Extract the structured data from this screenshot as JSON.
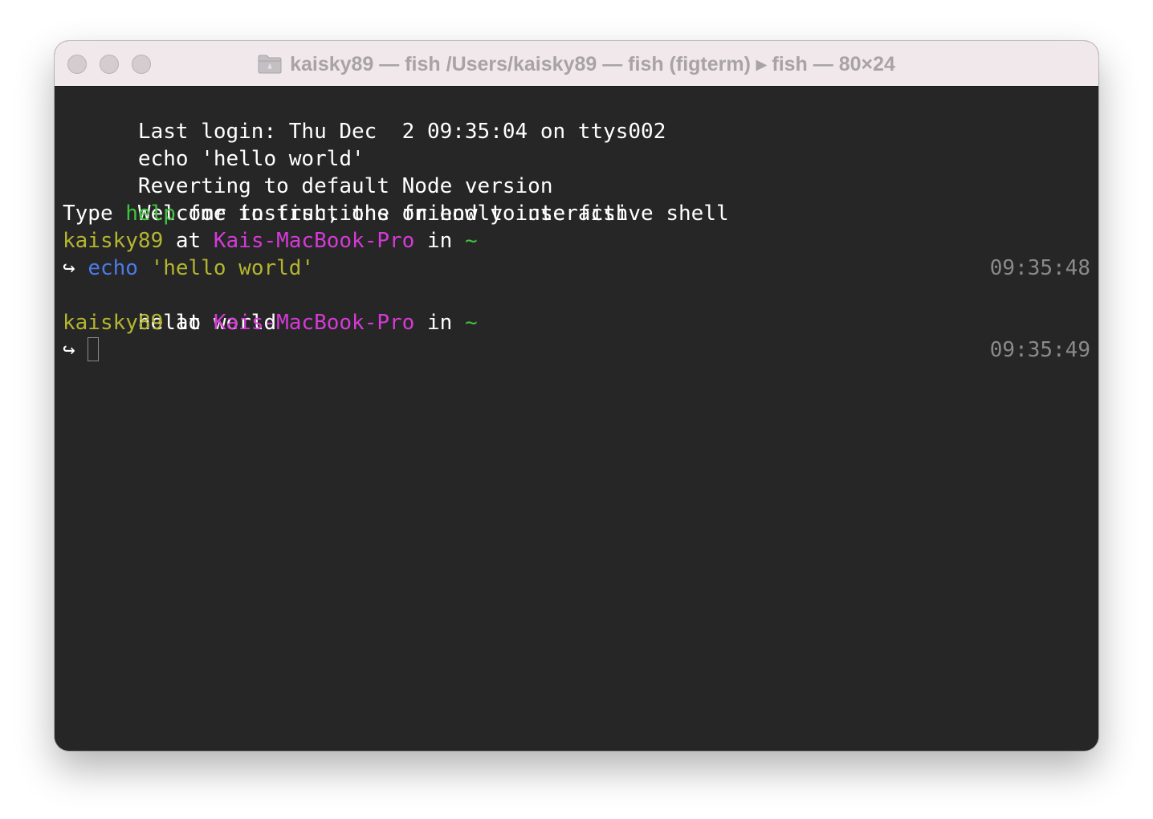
{
  "window": {
    "title": "kaisky89 — fish /Users/kaisky89 — fish (figterm) ▸ fish — 80×24",
    "folder_icon": "folder-icon"
  },
  "colors": {
    "background": "#262626",
    "text": "#ffffff",
    "green": "#3fc43f",
    "yellow": "#b4b530",
    "magenta": "#d53ad6",
    "blue": "#4b7bea",
    "timestamp": "#8a8a8a"
  },
  "terminal": {
    "last_login": "Last login: Thu Dec  2 09:35:04 on ttys002",
    "echo_line": "echo 'hello world'",
    "reverting": "Reverting to default Node version",
    "welcome": "Welcome to fish, the friendly interactive shell",
    "type_help": {
      "pre": "Type ",
      "help": "help",
      "post": " for instructions on how to use fish"
    },
    "prompt1": {
      "user": "kaisky89",
      "at": " at ",
      "host": "Kais-MacBook-Pro",
      "in": " in ",
      "dir": "~"
    },
    "command1": {
      "arrow": "↪",
      "cmd": "echo",
      "arg": "'hello world'",
      "timestamp": "09:35:48"
    },
    "output1": "hello world",
    "prompt2": {
      "user": "kaisky89",
      "at": " at ",
      "host": "Kais-MacBook-Pro",
      "in": " in ",
      "dir": "~"
    },
    "command2": {
      "arrow": "↪",
      "timestamp": "09:35:49"
    }
  }
}
